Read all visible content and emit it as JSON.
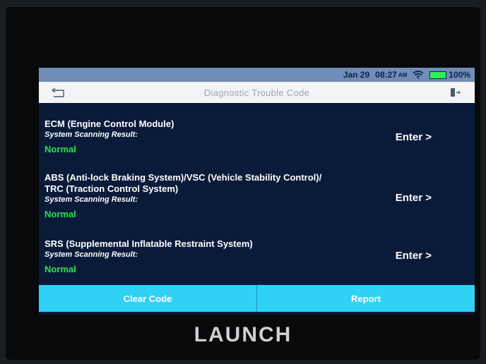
{
  "status_bar": {
    "date": "Jan 29",
    "time": "08:27",
    "ampm": "AM",
    "battery": "100%",
    "battery_color": "#2cf05a"
  },
  "title_bar": {
    "title": "Diagnostic Trouble Code",
    "back_icon": "back-arrow-icon",
    "exit_icon": "exit-icon"
  },
  "systems": [
    {
      "name": "ECM (Engine Control Module)",
      "result_label": "System Scanning Result:",
      "status": "Normal",
      "enter_label": "Enter >"
    },
    {
      "name_line1": "ABS (Anti-lock Braking System)/VSC (Vehicle Stability Control)/",
      "name_line2": "TRC (Traction Control System)",
      "result_label": "System Scanning Result:",
      "status": "Normal",
      "enter_label": "Enter >"
    },
    {
      "name": "SRS (Supplemental Inflatable Restraint System)",
      "result_label": "System Scanning Result:",
      "status": "Normal",
      "enter_label": "Enter >"
    }
  ],
  "actions": {
    "clear_code": "Clear Code",
    "report": "Report"
  },
  "brand": "LAUNCH",
  "colors": {
    "accent": "#2fd2f5",
    "status_normal": "#26e34a",
    "screen_bg": "#0a1b3a"
  }
}
